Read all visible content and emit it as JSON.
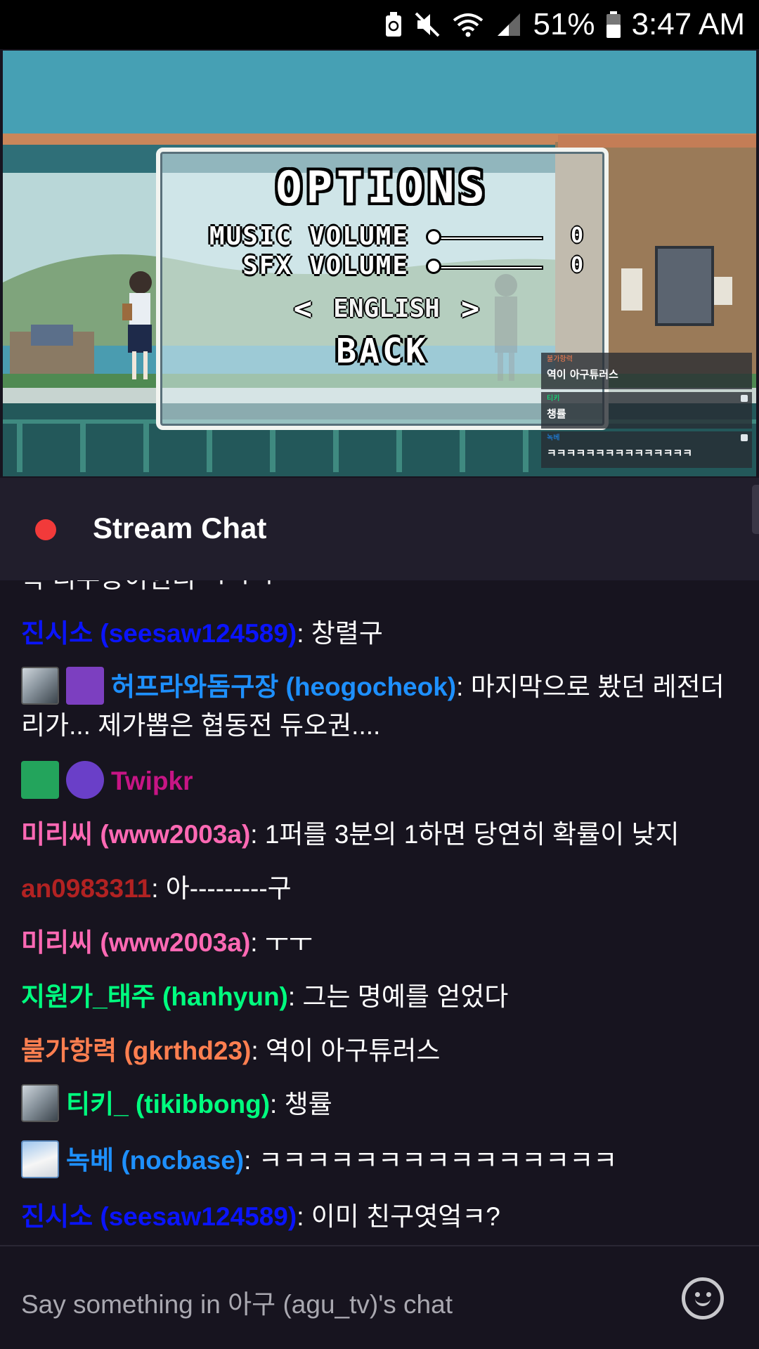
{
  "status_bar": {
    "battery": "51%",
    "time": "3:47 AM",
    "icons": [
      "battery-saver-icon",
      "mute-icon",
      "wifi-icon",
      "signal-icon",
      "battery-icon"
    ]
  },
  "game": {
    "title": "OPTIONS",
    "music_label": "MUSIC VOLUME",
    "music_value": "0",
    "music_level": 0,
    "sfx_label": "SFX VOLUME",
    "sfx_value": "0",
    "sfx_level": 0,
    "language": "ENGLISH",
    "lang_prev": "<",
    "lang_next": ">",
    "back": "BACK"
  },
  "overlay_chat": [
    {
      "name": "불가항력",
      "message": "역이 아구튜러스",
      "color": "#ff7f50"
    },
    {
      "name": "티키",
      "message": "챙률",
      "color": "#00ff7f"
    },
    {
      "name": "녹베",
      "message": "ㅋㅋㅋㅋㅋㅋㅋㅋㅋㅋㅋㅋㅋㅋㅋ",
      "color": "#1e90ff"
    }
  ],
  "chat": {
    "title": "Stream Chat",
    "partial_line": "ᆨ 디우응이힌디 ㅋㅋㅋ",
    "messages": [
      {
        "user": "진시소 (seesaw124589)",
        "sep": ": ",
        "text": "창렬구",
        "color": "#0a14ff"
      },
      {
        "user": "허프라와돔구장 (heogocheok)",
        "sep": ": ",
        "text": "마지막으로 봤던 레전더리가... 제가뽑은 협동전 듀오권....",
        "color": "#1e90ff"
      },
      {
        "user": "Twipkr",
        "sep": "",
        "text": "",
        "color": "#c71585"
      },
      {
        "user": "미리씨 (www2003a)",
        "sep": ": ",
        "text": "1퍼를 3분의 1하면 당연히 확률이 낮지",
        "color": "#ff69b4"
      },
      {
        "user": "an0983311",
        "sep": ": ",
        "text": "아---------구",
        "color": "#b22222"
      },
      {
        "user": "미리씨 (www2003a)",
        "sep": ": ",
        "text": "ㅜㅜ",
        "color": "#ff69b4"
      },
      {
        "user": "지원가_태주 (hanhyun)",
        "sep": ": ",
        "text": "그는 명예를 얻었다",
        "color": "#00ff7f"
      },
      {
        "user": "불가항력 (gkrthd23)",
        "sep": ": ",
        "text": "역이 아구튜러스",
        "color": "#ff7f50"
      },
      {
        "user": "티키_ (tikibbong)",
        "sep": ": ",
        "text": "챙률",
        "color": "#00ff7f"
      },
      {
        "user": "녹베 (nocbase)",
        "sep": ": ",
        "text": "ㅋㅋㅋㅋㅋㅋㅋㅋㅋㅋㅋㅋㅋㅋㅋ",
        "color": "#1e90ff"
      },
      {
        "user": "진시소 (seesaw124589)",
        "sep": ": ",
        "text": "이미 친구엿엌ㅋ?",
        "color": "#0a14ff"
      }
    ]
  },
  "input": {
    "placeholder": "Say something in 아구 (agu_tv)'s chat"
  }
}
